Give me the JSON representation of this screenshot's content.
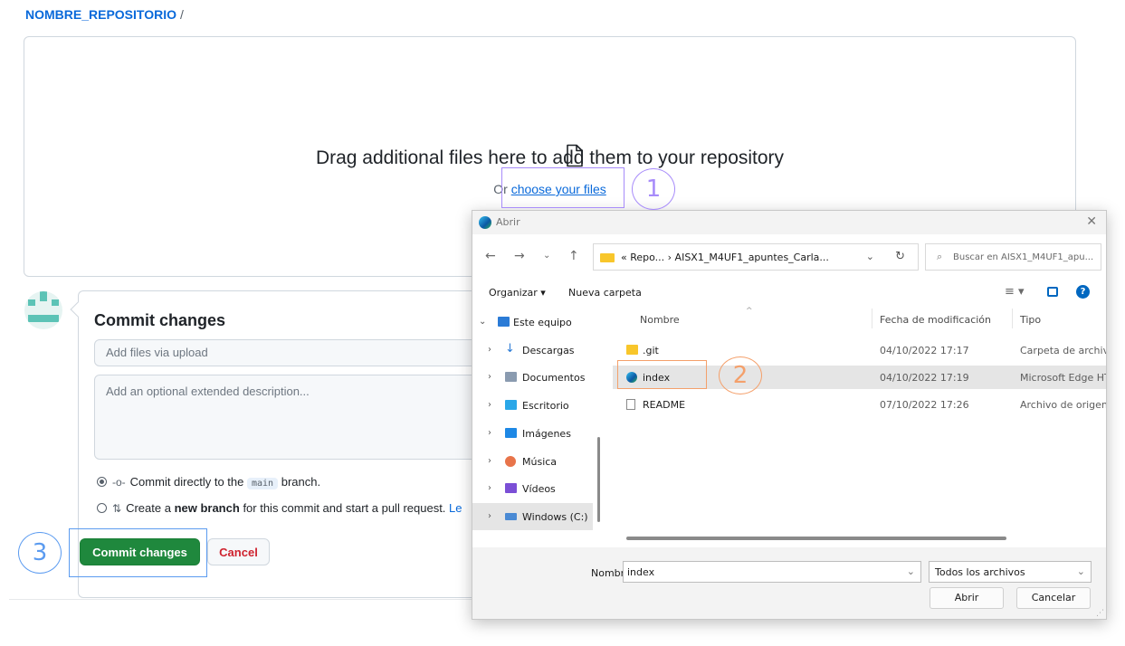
{
  "breadcrumb": {
    "repo": "NOMBRE_REPOSITORIO",
    "separator": "/"
  },
  "dropzone": {
    "title": "Drag additional files here to add them to your repository",
    "prefix": "Or",
    "link": "choose your files"
  },
  "commit": {
    "title": "Commit changes",
    "summary_placeholder": "Add files via upload",
    "description_placeholder": "Add an optional extended description...",
    "option_direct": {
      "before": "Commit directly to the",
      "branch": "main",
      "after": "branch."
    },
    "option_new": {
      "before": "Create a",
      "bold": "new branch",
      "after": "for this commit and start a pull request.",
      "link": "Le"
    },
    "commit_button": "Commit changes",
    "cancel_button": "Cancel"
  },
  "annotations": {
    "one": "1",
    "two": "2",
    "three": "3"
  },
  "annotation_colors": {
    "one": "#a78bfa",
    "two": "#f4a06b",
    "three": "#5b9bf0"
  },
  "dialog": {
    "title": "Abrir",
    "path": "« Repo...  ›  AISX1_M4UF1_apuntes_Carla...",
    "search_placeholder": "Buscar en AISX1_M4UF1_apu...",
    "toolbar": {
      "organize": "Organizar ▾",
      "new_folder": "Nueva carpeta"
    },
    "nav": [
      {
        "label": "Este equipo",
        "icon": "monitor-icon",
        "chevron": "⌄"
      },
      {
        "label": "Descargas",
        "icon": "download-icon",
        "chevron": "›"
      },
      {
        "label": "Documentos",
        "icon": "document-icon",
        "chevron": "›"
      },
      {
        "label": "Escritorio",
        "icon": "desktop-icon",
        "chevron": "›"
      },
      {
        "label": "Imágenes",
        "icon": "image-icon",
        "chevron": "›"
      },
      {
        "label": "Música",
        "icon": "music-icon",
        "chevron": "›"
      },
      {
        "label": "Vídeos",
        "icon": "video-icon",
        "chevron": "›"
      },
      {
        "label": "Windows (C:)",
        "icon": "drive-icon",
        "chevron": "›"
      }
    ],
    "columns": {
      "name": "Nombre",
      "date": "Fecha de modificación",
      "type": "Tipo"
    },
    "files": [
      {
        "name": ".git",
        "date": "04/10/2022 17:17",
        "type": "Carpeta de archivos",
        "icon": "folder-icon"
      },
      {
        "name": "index",
        "date": "04/10/2022 17:19",
        "type": "Microsoft Edge HTML",
        "icon": "edge-icon"
      },
      {
        "name": "README",
        "date": "07/10/2022 17:26",
        "type": "Archivo de origen Markdown",
        "icon": "markdown-file-icon"
      }
    ],
    "footer": {
      "name_label": "Nombre:",
      "name_value": "index",
      "file_type": "Todos los archivos",
      "open_button": "Abrir",
      "cancel_button": "Cancelar"
    }
  }
}
